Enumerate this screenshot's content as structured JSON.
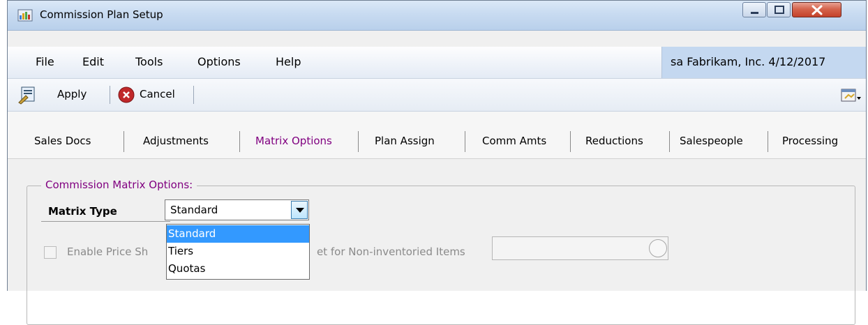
{
  "window": {
    "title": "Commission Plan Setup",
    "icons": {
      "app": "app-icon",
      "minimize": "minimize-icon",
      "maximize": "maximize-icon",
      "close": "close-icon"
    }
  },
  "menu": {
    "items": [
      "File",
      "Edit",
      "Tools",
      "Options",
      "Help"
    ],
    "userinfo": "sa  Fabrikam, Inc.  4/12/2017"
  },
  "toolbar": {
    "apply_label": "Apply",
    "cancel_label": "Cancel",
    "icons": {
      "apply": "apply-icon",
      "cancel": "cancel-icon",
      "options": "window-options-icon"
    }
  },
  "tabs": {
    "items": [
      "Sales Docs",
      "Adjustments",
      "Matrix Options",
      "Plan Assign",
      "Comm Amts",
      "Reductions",
      "Salespeople",
      "Processing"
    ],
    "active": "Matrix Options"
  },
  "group": {
    "legend": "Commission Matrix Options:",
    "matrix_type_label": "Matrix Type",
    "matrix_type_value": "Standard",
    "options": [
      "Standard",
      "Tiers",
      "Quotas"
    ],
    "highlighted_option": "Standard",
    "enable_label_head": "Enable Price Sh",
    "enable_label_tail": "et for Non-inventoried Items",
    "enable_checked": false,
    "price_sheet_value": ""
  },
  "colors": {
    "tab_active": "#800080",
    "legend": "#800080",
    "highlight": "#3399ff",
    "userinfo_bg": "#c4d8f0"
  }
}
